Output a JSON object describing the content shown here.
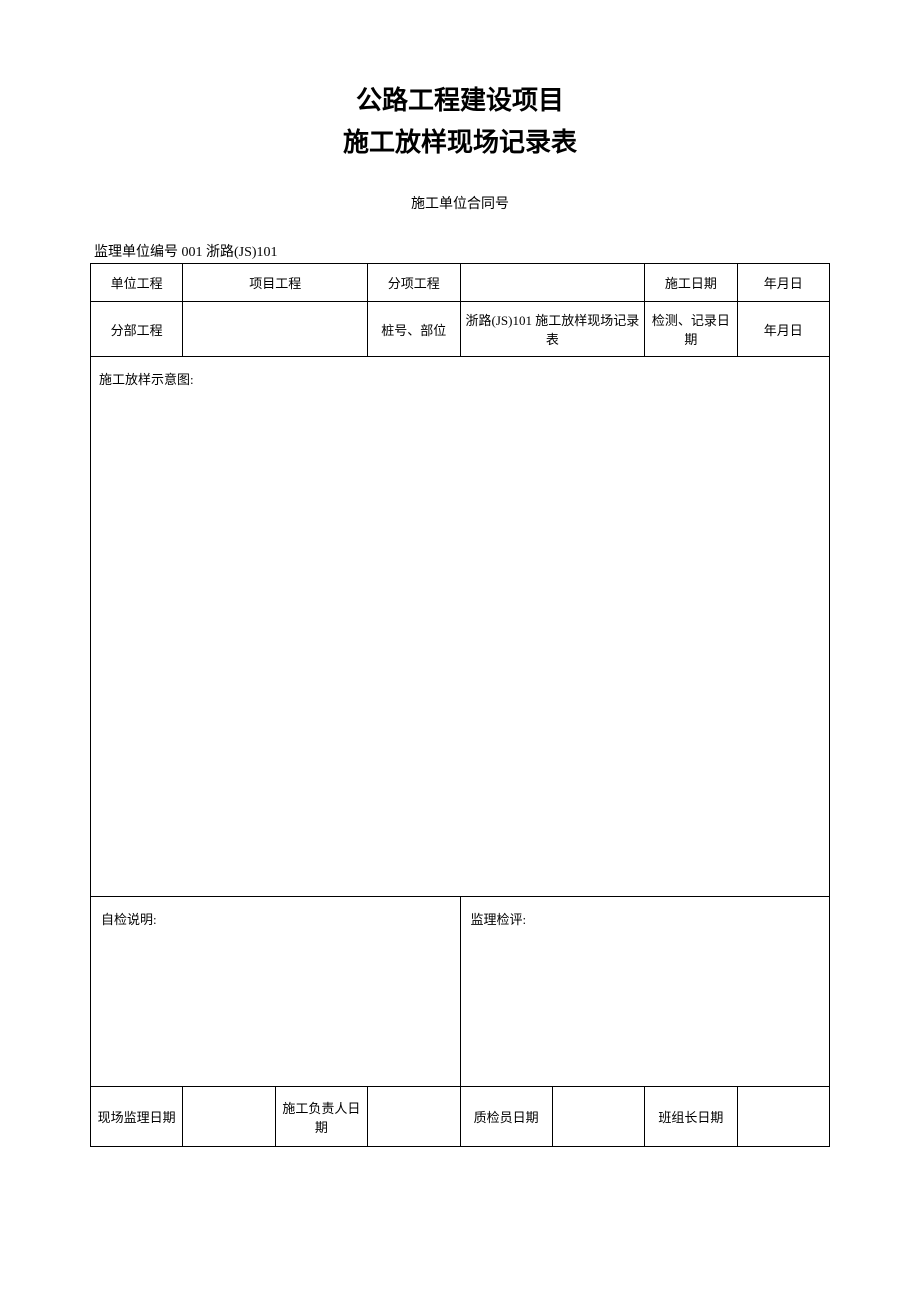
{
  "title": {
    "line1": "公路工程建设项目",
    "line2": "施工放样现场记录表"
  },
  "contract_line": "施工单位合同号",
  "supervisor_line": "监理单位编号 001 浙路(JS)101",
  "header": {
    "unit_project_label": "单位工程",
    "project_label": "项目工程",
    "sub_item_label": "分项工程",
    "sub_item_value": "",
    "construct_date_label": "施工日期",
    "construct_date_value": "年月日",
    "division_label": "分部工程",
    "division_value": "",
    "pile_label": "桩号、部位",
    "pile_value": "浙路(JS)101 施工放样现场记录表",
    "inspect_date_label": "检测、记录日期",
    "inspect_date_value": "年月日"
  },
  "diagram_label": "施工放样示意图:",
  "self_check_label": "自检说明:",
  "supervisor_review_label": "监理检评:",
  "sign": {
    "site_supervisor_label": "现场监理日期",
    "site_supervisor_value": "",
    "construction_manager_label": "施工负责人日期",
    "construction_manager_value": "",
    "qc_label": "质检员日期",
    "qc_value": "",
    "team_leader_label": "班组长日期",
    "team_leader_value": ""
  }
}
